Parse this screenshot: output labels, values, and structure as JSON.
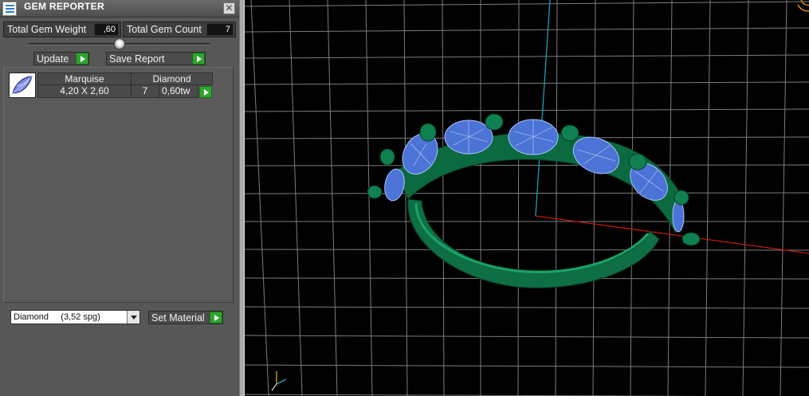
{
  "window": {
    "title": "GEM REPORTER",
    "close_label": "✕"
  },
  "stats": {
    "weight_label": "Total Gem Weight",
    "weight_value": ",60",
    "count_label": "Total Gem Count",
    "count_value": "7"
  },
  "buttons": {
    "update_label": "Update",
    "save_label": "Save Report",
    "set_material_label": "Set Material"
  },
  "gem_table": {
    "headers": [
      "Marquise",
      "Diamond"
    ],
    "row": {
      "size": "4,20 X 2,60",
      "count": "7",
      "weight": "0,60tw"
    }
  },
  "material": {
    "selected": "Diamond     (3,52 spg)"
  },
  "icons": {
    "app": "gem-reporter-app-icon",
    "close": "close-icon",
    "play": "play-icon",
    "gem": "marquise-gem-icon",
    "dropdown": "chevron-down-icon",
    "axis_gizmo": "axis-gizmo-icon"
  },
  "colors": {
    "panel_bg": "#575757",
    "accent_green": "#2fa52f",
    "metal": "#0e7a4a",
    "stone": "#4c74d6",
    "grid": "#8a8a8a",
    "axis_x": "#c01818",
    "axis_y": "#1aa0b8"
  }
}
